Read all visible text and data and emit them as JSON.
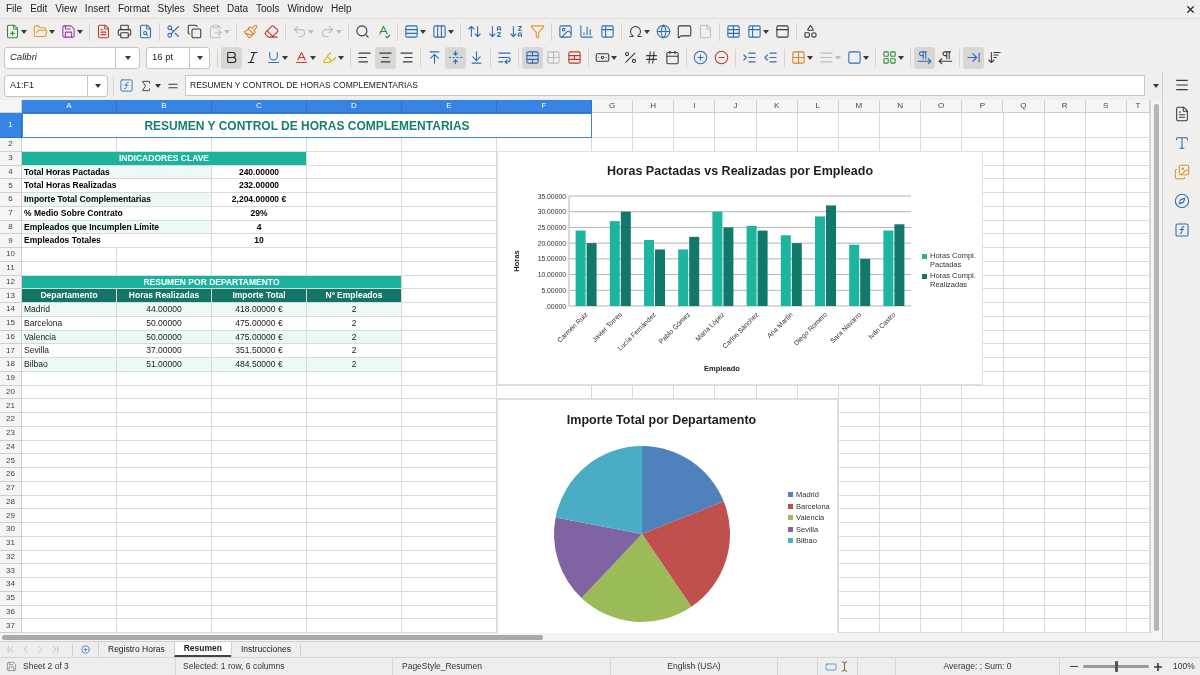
{
  "menu": [
    "File",
    "Edit",
    "View",
    "Insert",
    "Format",
    "Styles",
    "Sheet",
    "Data",
    "Tools",
    "Window",
    "Help"
  ],
  "standard_toolbar": {
    "groups": [
      [
        {
          "kind": "new",
          "dropdown": true,
          "disabled": false
        },
        {
          "kind": "open",
          "dropdown": true,
          "disabled": false
        },
        {
          "kind": "save",
          "dropdown": true,
          "disabled": false
        }
      ],
      [
        {
          "kind": "export_pdf",
          "dropdown": false,
          "disabled": false
        },
        {
          "kind": "print",
          "dropdown": false,
          "disabled": false
        },
        {
          "kind": "print_preview",
          "dropdown": false,
          "disabled": false
        }
      ],
      [
        {
          "kind": "cut",
          "dropdown": false,
          "disabled": false
        },
        {
          "kind": "copy",
          "dropdown": false,
          "disabled": false
        },
        {
          "kind": "paste",
          "dropdown": true,
          "disabled": true
        }
      ],
      [
        {
          "kind": "clone_formatting",
          "dropdown": false,
          "disabled": false
        },
        {
          "kind": "clear_formatting",
          "dropdown": false,
          "disabled": false
        }
      ],
      [
        {
          "kind": "undo",
          "dropdown": true,
          "disabled": true
        },
        {
          "kind": "redo",
          "dropdown": true,
          "disabled": true
        }
      ],
      [
        {
          "kind": "find_replace",
          "dropdown": false,
          "disabled": false
        },
        {
          "kind": "spelling",
          "dropdown": false,
          "disabled": false
        }
      ],
      [
        {
          "kind": "row",
          "dropdown": true,
          "disabled": false
        },
        {
          "kind": "column",
          "dropdown": true,
          "disabled": false
        }
      ],
      [
        {
          "kind": "sort",
          "dropdown": false,
          "disabled": false
        },
        {
          "kind": "sort_ascending",
          "dropdown": false,
          "disabled": false
        },
        {
          "kind": "sort_descending",
          "dropdown": false,
          "disabled": false
        },
        {
          "kind": "autofilter",
          "dropdown": false,
          "disabled": false
        }
      ],
      [
        {
          "kind": "image",
          "dropdown": false,
          "disabled": false
        },
        {
          "kind": "chart",
          "dropdown": false,
          "disabled": false
        },
        {
          "kind": "pivot_table",
          "dropdown": false,
          "disabled": false
        }
      ],
      [
        {
          "kind": "special_character",
          "dropdown": true,
          "disabled": false
        },
        {
          "kind": "hyperlink",
          "dropdown": false,
          "disabled": false
        },
        {
          "kind": "comment",
          "dropdown": false,
          "disabled": false
        },
        {
          "kind": "header_footer",
          "dropdown": false,
          "disabled": true
        }
      ],
      [
        {
          "kind": "print_area",
          "dropdown": false,
          "disabled": false
        },
        {
          "kind": "freeze",
          "dropdown": true,
          "disabled": false
        },
        {
          "kind": "split_window",
          "dropdown": false,
          "disabled": false
        }
      ],
      [
        {
          "kind": "shapes",
          "dropdown": false,
          "disabled": false
        }
      ]
    ]
  },
  "format_toolbar": {
    "font_name": "Calibri",
    "font_size": "16 pt",
    "groups": [
      [
        {
          "kind": "bold",
          "pressed": true,
          "dropdown": false,
          "disabled": false
        },
        {
          "kind": "italic",
          "pressed": false,
          "dropdown": false,
          "disabled": false
        },
        {
          "kind": "underline",
          "pressed": false,
          "dropdown": true,
          "disabled": false
        },
        {
          "kind": "font_color",
          "pressed": false,
          "dropdown": true,
          "disabled": false
        },
        {
          "kind": "highlight",
          "pressed": false,
          "dropdown": true,
          "disabled": false
        }
      ],
      [
        {
          "kind": "align_left",
          "pressed": false,
          "dropdown": false,
          "disabled": false
        },
        {
          "kind": "align_center",
          "pressed": true,
          "dropdown": false,
          "disabled": false
        },
        {
          "kind": "align_right",
          "pressed": false,
          "dropdown": false,
          "disabled": false
        }
      ],
      [
        {
          "kind": "align_top",
          "pressed": false,
          "dropdown": false,
          "disabled": false
        },
        {
          "kind": "align_middle",
          "pressed": true,
          "dropdown": false,
          "disabled": false
        },
        {
          "kind": "align_bottom",
          "pressed": false,
          "dropdown": false,
          "disabled": false
        }
      ],
      [
        {
          "kind": "wrap_text",
          "pressed": false,
          "dropdown": false,
          "disabled": false
        }
      ],
      [
        {
          "kind": "merge_center",
          "pressed": true,
          "dropdown": false,
          "disabled": false
        },
        {
          "kind": "merge_cells",
          "pressed": false,
          "dropdown": false,
          "disabled": true
        },
        {
          "kind": "unmerge_cells",
          "pressed": false,
          "dropdown": false,
          "disabled": false
        }
      ],
      [
        {
          "kind": "number_format",
          "pressed": false,
          "dropdown": true,
          "disabled": false
        },
        {
          "kind": "percent",
          "pressed": false,
          "dropdown": false,
          "disabled": false
        },
        {
          "kind": "standard_format",
          "pressed": false,
          "dropdown": false,
          "disabled": false
        },
        {
          "kind": "date",
          "pressed": false,
          "dropdown": false,
          "disabled": false
        }
      ],
      [
        {
          "kind": "add_decimal",
          "pressed": false,
          "dropdown": false,
          "disabled": false
        },
        {
          "kind": "delete_decimal",
          "pressed": false,
          "dropdown": false,
          "disabled": false
        }
      ],
      [
        {
          "kind": "indent_increase",
          "pressed": false,
          "dropdown": false,
          "disabled": false
        },
        {
          "kind": "indent_decrease",
          "pressed": false,
          "dropdown": false,
          "disabled": false
        }
      ],
      [
        {
          "kind": "borders",
          "pressed": false,
          "dropdown": true,
          "disabled": false
        },
        {
          "kind": "border_style",
          "pressed": false,
          "dropdown": true,
          "disabled": true
        },
        {
          "kind": "border_color",
          "pressed": false,
          "dropdown": true,
          "disabled": false
        }
      ],
      [
        {
          "kind": "conditional",
          "pressed": false,
          "dropdown": true,
          "disabled": false
        }
      ],
      [
        {
          "kind": "left_to_right",
          "pressed": true,
          "dropdown": false,
          "disabled": false
        },
        {
          "kind": "right_to_left",
          "pressed": false,
          "dropdown": false,
          "disabled": false
        }
      ],
      [
        {
          "kind": "text_direction_lr",
          "pressed": true,
          "dropdown": false,
          "disabled": false
        },
        {
          "kind": "text_direction_tb",
          "pressed": false,
          "dropdown": false,
          "disabled": false
        }
      ]
    ]
  },
  "formula_bar": {
    "name_box": "A1:F1",
    "content": "RESUMEN Y CONTROL DE HORAS COMPLEMENTARIAS"
  },
  "sheet": {
    "columns": [
      {
        "label": "A",
        "selected": true
      },
      {
        "label": "B",
        "selected": true
      },
      {
        "label": "C",
        "selected": true
      },
      {
        "label": "D",
        "selected": true
      },
      {
        "label": "E",
        "selected": true
      },
      {
        "label": "F",
        "selected": true
      },
      {
        "label": "G",
        "selected": false
      },
      {
        "label": "H",
        "selected": false
      },
      {
        "label": "I",
        "selected": false
      },
      {
        "label": "J",
        "selected": false
      },
      {
        "label": "K",
        "selected": false
      },
      {
        "label": "L",
        "selected": false
      },
      {
        "label": "M",
        "selected": false
      },
      {
        "label": "N",
        "selected": false
      },
      {
        "label": "O",
        "selected": false
      },
      {
        "label": "P",
        "selected": false
      },
      {
        "label": "Q",
        "selected": false
      },
      {
        "label": "R",
        "selected": false
      },
      {
        "label": "S",
        "selected": false
      },
      {
        "label": "T",
        "selected": false
      }
    ],
    "rows": [
      {
        "label": "1",
        "selected": true
      },
      {
        "label": "2",
        "selected": false
      },
      {
        "label": "3",
        "selected": false
      },
      {
        "label": "4",
        "selected": false
      },
      {
        "label": "5",
        "selected": false
      },
      {
        "label": "6",
        "selected": false
      },
      {
        "label": "7",
        "selected": false
      },
      {
        "label": "8",
        "selected": false
      },
      {
        "label": "9",
        "selected": false
      },
      {
        "label": "10",
        "selected": false
      },
      {
        "label": "11",
        "selected": false
      },
      {
        "label": "12",
        "selected": false
      },
      {
        "label": "13",
        "selected": false
      },
      {
        "label": "14",
        "selected": false
      },
      {
        "label": "15",
        "selected": false
      },
      {
        "label": "16",
        "selected": false
      },
      {
        "label": "17",
        "selected": false
      },
      {
        "label": "18",
        "selected": false
      },
      {
        "label": "19",
        "selected": false
      },
      {
        "label": "20",
        "selected": false
      },
      {
        "label": "21",
        "selected": false
      },
      {
        "label": "22",
        "selected": false
      },
      {
        "label": "23",
        "selected": false
      },
      {
        "label": "24",
        "selected": false
      },
      {
        "label": "25",
        "selected": false
      },
      {
        "label": "26",
        "selected": false
      },
      {
        "label": "27",
        "selected": false
      },
      {
        "label": "28",
        "selected": false
      },
      {
        "label": "29",
        "selected": false
      },
      {
        "label": "30",
        "selected": false
      },
      {
        "label": "31",
        "selected": false
      },
      {
        "label": "32",
        "selected": false
      },
      {
        "label": "33",
        "selected": false
      },
      {
        "label": "34",
        "selected": false
      },
      {
        "label": "35",
        "selected": false
      },
      {
        "label": "36",
        "selected": false
      },
      {
        "label": "37",
        "selected": false
      }
    ],
    "title": {
      "text": "RESUMEN Y CONTROL DE HORAS COMPLEMENTARIAS",
      "selected": true
    },
    "key_indicators": {
      "heading": "INDICADORES CLAVE",
      "rows": [
        {
          "label": "Total Horas Pactadas",
          "value": "240.00000"
        },
        {
          "label": "Total Horas Realizadas",
          "value": "232.00000"
        },
        {
          "label": "Importe Total Complementarias",
          "value": "2,204.00000 €"
        },
        {
          "label": "% Medio Sobre Contrato",
          "value": "29%"
        },
        {
          "label": "Empleados que Incumplen Límite",
          "value": "4"
        },
        {
          "label": "Empleados Totales",
          "value": "10"
        }
      ]
    },
    "department_summary": {
      "heading": "RESUMEN POR DEPARTAMENTO",
      "columns": [
        "Departamento",
        "Horas Realizadas",
        "Importe Total",
        "Nº Empleados"
      ],
      "rows": [
        [
          "Madrid",
          "44.00000",
          "418.00000 €",
          "2"
        ],
        [
          "Barcelona",
          "50.00000",
          "475.00000 €",
          "2"
        ],
        [
          "Valencia",
          "50.00000",
          "475.00000 €",
          "2"
        ],
        [
          "Sevilla",
          "37.00000",
          "351.50000 €",
          "2"
        ],
        [
          "Bilbao",
          "51.00000",
          "484.50000 €",
          "2"
        ]
      ]
    }
  },
  "charts": [
    {
      "chart_data": {
        "type": "bar",
        "title": "Horas Pactadas vs Realizadas por Empleado",
        "xlabel": "Empleado",
        "ylabel": "Horas",
        "categories": [
          "Carmen Ruiz",
          "Javier Torres",
          "Lucía Fernández",
          "Pablo Gómez",
          "María López",
          "Carlos Sánchez",
          "Ana Martín",
          "Diego Romero",
          "Sara Navarro",
          "Iván Castro"
        ],
        "series": [
          {
            "name": "Horas Compl. Pactadas",
            "color": "#1bb5a0",
            "values": [
              24,
              27,
              21,
              18,
              30,
              25.5,
              22.5,
              28.5,
              19.5,
              24
            ]
          },
          {
            "name": "Horas Compl. Realizadas",
            "color": "#12786b",
            "values": [
              20,
              30,
              18,
              22,
              25,
              24,
              20,
              32,
              15,
              26
            ]
          }
        ],
        "ylim": [
          0,
          35
        ],
        "yticks": [
          {
            "value": 0,
            "label": ".00000"
          },
          {
            "value": 5,
            "label": "5.00000"
          },
          {
            "value": 10,
            "label": "10.00000"
          },
          {
            "value": 15,
            "label": "15.00000"
          },
          {
            "value": 20,
            "label": "20.00000"
          },
          {
            "value": 25,
            "label": "25.00000"
          },
          {
            "value": 30,
            "label": "30.00000"
          },
          {
            "value": 35,
            "label": "35.00000"
          }
        ],
        "grid": true,
        "legend": "right"
      }
    },
    {
      "chart_data": {
        "type": "pie",
        "title": "Importe Total por Departamento",
        "categories": [
          "Madrid",
          "Barcelona",
          "Valencia",
          "Sevilla",
          "Bilbao"
        ],
        "values": [
          18.97,
          21.55,
          21.55,
          15.95,
          21.98
        ],
        "legend": "right"
      }
    }
  ],
  "sheet_tabs": [
    {
      "label": "Registro Horas",
      "selected": false
    },
    {
      "label": "Resumen",
      "selected": true
    },
    {
      "label": "Instrucciones",
      "selected": false
    }
  ],
  "status_bar": {
    "sheet_position": "Sheet 2 of 3",
    "selection": "Selected: 1 row, 6 columns",
    "page_style": "PageStyle_Resumen",
    "language": "English (USA)",
    "statistics": "Average: ; Sum: 0",
    "zoom_slider": {
      "level": 0.5
    },
    "zoom": "100%"
  }
}
